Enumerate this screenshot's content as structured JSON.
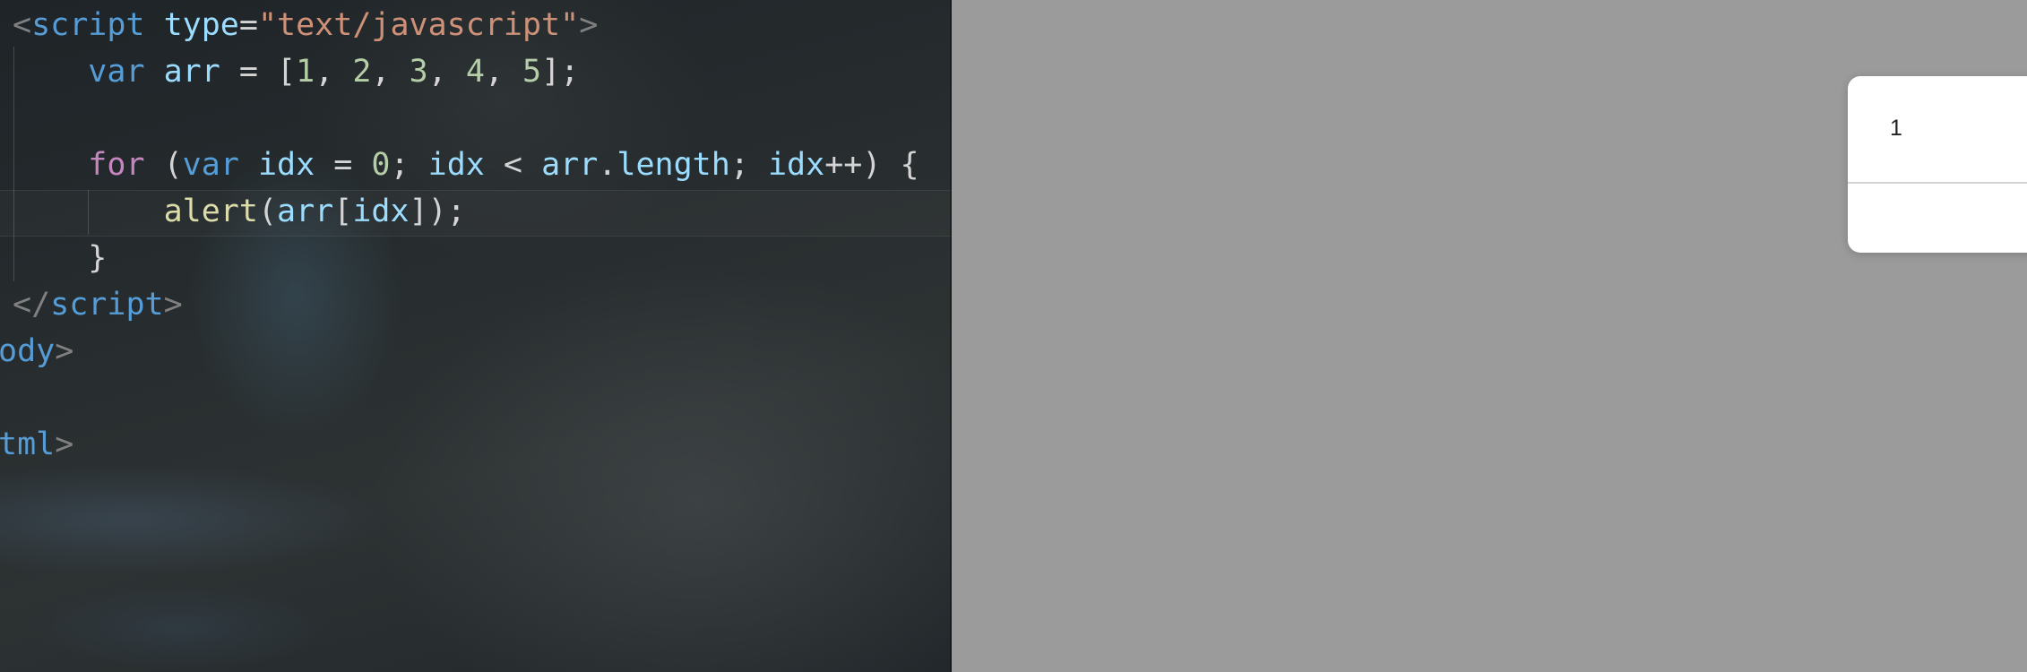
{
  "editor": {
    "theme_colors": {
      "punctuation": "#808080",
      "tag": "#569cd6",
      "attribute": "#9cdcfe",
      "string": "#ce9178",
      "keyword": "#569cd6",
      "control": "#c586c0",
      "variable": "#9cdcfe",
      "number": "#b5cea8",
      "function": "#dcdcaa",
      "text": "#d4d4d4"
    },
    "lines": [
      {
        "tokens": [
          {
            "type": "punct",
            "text": "<"
          },
          {
            "type": "tag",
            "text": "script"
          },
          {
            "type": "plain",
            "text": " "
          },
          {
            "type": "attr",
            "text": "type"
          },
          {
            "type": "plain",
            "text": "="
          },
          {
            "type": "str",
            "text": "\"text/javascript\""
          },
          {
            "type": "punct",
            "text": ">"
          }
        ]
      },
      {
        "tokens": [
          {
            "type": "plain",
            "text": "    "
          },
          {
            "type": "kw",
            "text": "var"
          },
          {
            "type": "plain",
            "text": " "
          },
          {
            "type": "var",
            "text": "arr"
          },
          {
            "type": "plain",
            "text": " = ["
          },
          {
            "type": "num",
            "text": "1"
          },
          {
            "type": "plain",
            "text": ", "
          },
          {
            "type": "num",
            "text": "2"
          },
          {
            "type": "plain",
            "text": ", "
          },
          {
            "type": "num",
            "text": "3"
          },
          {
            "type": "plain",
            "text": ", "
          },
          {
            "type": "num",
            "text": "4"
          },
          {
            "type": "plain",
            "text": ", "
          },
          {
            "type": "num",
            "text": "5"
          },
          {
            "type": "plain",
            "text": "];"
          }
        ]
      },
      {
        "tokens": [
          {
            "type": "plain",
            "text": " "
          }
        ]
      },
      {
        "tokens": [
          {
            "type": "plain",
            "text": "    "
          },
          {
            "type": "ctrl",
            "text": "for"
          },
          {
            "type": "plain",
            "text": " ("
          },
          {
            "type": "kw",
            "text": "var"
          },
          {
            "type": "plain",
            "text": " "
          },
          {
            "type": "var",
            "text": "idx"
          },
          {
            "type": "plain",
            "text": " = "
          },
          {
            "type": "num",
            "text": "0"
          },
          {
            "type": "plain",
            "text": "; "
          },
          {
            "type": "var",
            "text": "idx"
          },
          {
            "type": "plain",
            "text": " < "
          },
          {
            "type": "var",
            "text": "arr"
          },
          {
            "type": "plain",
            "text": "."
          },
          {
            "type": "var",
            "text": "length"
          },
          {
            "type": "plain",
            "text": "; "
          },
          {
            "type": "var",
            "text": "idx"
          },
          {
            "type": "plain",
            "text": "++) {"
          }
        ]
      },
      {
        "tokens": [
          {
            "type": "plain",
            "text": "        "
          },
          {
            "type": "fn",
            "text": "alert"
          },
          {
            "type": "plain",
            "text": "("
          },
          {
            "type": "var",
            "text": "arr"
          },
          {
            "type": "plain",
            "text": "["
          },
          {
            "type": "var",
            "text": "idx"
          },
          {
            "type": "plain",
            "text": "]);"
          }
        ]
      },
      {
        "tokens": [
          {
            "type": "plain",
            "text": "    }"
          }
        ]
      },
      {
        "tokens": [
          {
            "type": "punct",
            "text": "</"
          },
          {
            "type": "tag",
            "text": "script"
          },
          {
            "type": "punct",
            "text": ">"
          }
        ]
      },
      {
        "tokens": [
          {
            "type": "tag",
            "text": "ody"
          },
          {
            "type": "punct",
            "text": ">"
          }
        ]
      },
      {
        "tokens": [
          {
            "type": "plain",
            "text": " "
          }
        ]
      },
      {
        "tokens": [
          {
            "type": "tag",
            "text": "tml"
          },
          {
            "type": "punct",
            "text": ">"
          }
        ]
      }
    ]
  },
  "alert": {
    "message": "1"
  }
}
